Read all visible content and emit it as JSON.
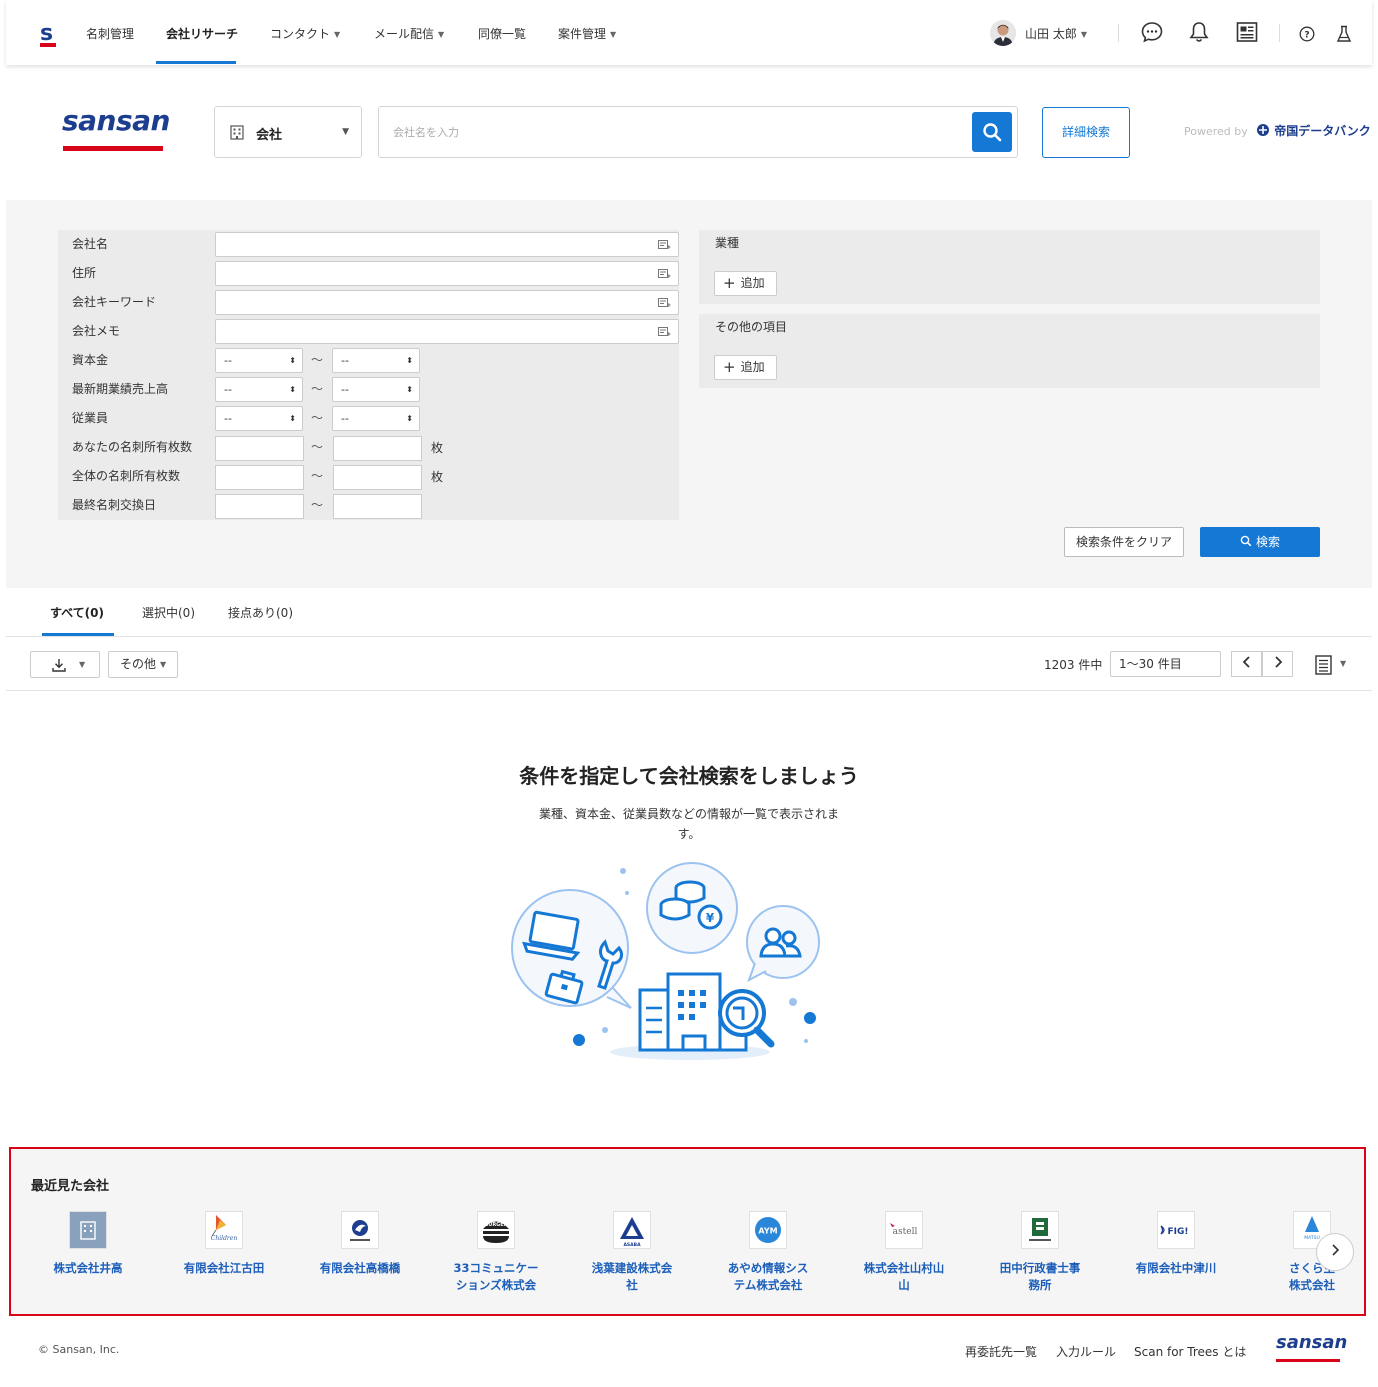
{
  "nav": {
    "items": [
      {
        "label": "名刺管理",
        "dropdown": false
      },
      {
        "label": "会社リサーチ",
        "dropdown": false,
        "active": true
      },
      {
        "label": "コンタクト",
        "dropdown": true
      },
      {
        "label": "メール配信",
        "dropdown": true
      },
      {
        "label": "同僚一覧",
        "dropdown": false
      },
      {
        "label": "案件管理",
        "dropdown": true
      }
    ],
    "user_name": "山田 太郎",
    "icons": [
      "chat-icon",
      "bell-icon",
      "news-icon",
      "help-icon",
      "flask-icon"
    ]
  },
  "header": {
    "brand": "sansan",
    "search_type": "会社",
    "search_placeholder": "会社名を入力",
    "advanced_search": "詳細検索",
    "powered_by": "Powered by",
    "provider": "帝国データバンク"
  },
  "conditions": {
    "rows": [
      {
        "label": "会社名",
        "kind": "text"
      },
      {
        "label": "住所",
        "kind": "text"
      },
      {
        "label": "会社キーワード",
        "kind": "text"
      },
      {
        "label": "会社メモ",
        "kind": "text"
      },
      {
        "label": "資本金",
        "kind": "select",
        "from": "--",
        "to": "--"
      },
      {
        "label": "最新期業績売上高",
        "kind": "select",
        "from": "--",
        "to": "--"
      },
      {
        "label": "従業員",
        "kind": "select",
        "from": "--",
        "to": "--"
      },
      {
        "label": "あなたの名刺所有枚数",
        "kind": "number",
        "unit": "枚"
      },
      {
        "label": "全体の名刺所有枚数",
        "kind": "number",
        "unit": "枚"
      },
      {
        "label": "最終名刺交換日",
        "kind": "number",
        "unit": ""
      }
    ],
    "tilde": "〜",
    "industry_label": "業種",
    "other_label": "その他の項目",
    "add_label": "追加",
    "clear_label": "検索条件をクリア",
    "search_label": "検索"
  },
  "tabs": [
    {
      "label": "すべて(0)",
      "active": true
    },
    {
      "label": "選択中(0)"
    },
    {
      "label": "接点あり(0)"
    }
  ],
  "toolbar": {
    "other_label": "その他",
    "total": "1203 件中",
    "range": "1〜30 件目"
  },
  "empty": {
    "title": "条件を指定して会社検索をしましょう",
    "desc_line1": "業種、資本金、従業員数などの情報が一覧で表示されま",
    "desc_line2": "す。"
  },
  "recent": {
    "title": "最近見た会社",
    "companies": [
      {
        "line1": "株式会社井高",
        "line2": ""
      },
      {
        "line1": "有限会社江古田",
        "line2": ""
      },
      {
        "line1": "有限会社高橋橋",
        "line2": ""
      },
      {
        "line1": "33コミュニケー",
        "line2": "ションズ株式会"
      },
      {
        "line1": "浅葉建設株式会",
        "line2": "社"
      },
      {
        "line1": "あやめ情報シス",
        "line2": "テム株式会社"
      },
      {
        "line1": "株式会社山村山",
        "line2": "山"
      },
      {
        "line1": "田中行政書士事",
        "line2": "務所"
      },
      {
        "line1": "有限会社中津川",
        "line2": ""
      },
      {
        "line1": "さくら生",
        "line2": "株式会社"
      }
    ],
    "logo_texts": [
      "",
      "Children",
      "",
      "BURGER",
      "ASABA",
      "AYM",
      "astell",
      "",
      "FIG!",
      "MATSU"
    ]
  },
  "footer": {
    "copyright": "© Sansan, Inc.",
    "links": [
      "再委託先一覧",
      "入力ルール",
      "Scan for Trees とは"
    ],
    "brand": "sansan"
  },
  "colors": {
    "accent": "#1478d4",
    "brand_navy": "#1d3e8e",
    "brand_red": "#d9041a"
  }
}
